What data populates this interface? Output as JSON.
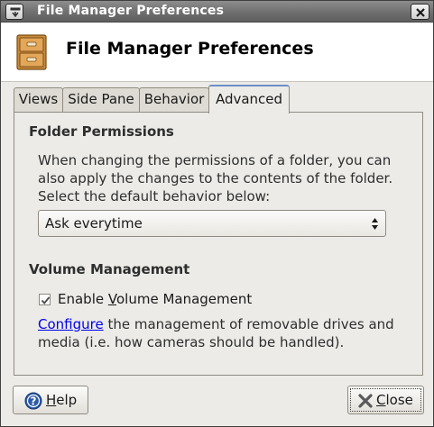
{
  "window": {
    "title": "File Manager Preferences",
    "menu_icon": "window-menu-icon",
    "close_icon": "close-icon"
  },
  "header": {
    "title": "File Manager Preferences",
    "icon": "file-cabinet-icon"
  },
  "tabs": [
    {
      "label": "Views",
      "active": false
    },
    {
      "label": "Side Pane",
      "active": false
    },
    {
      "label": "Behavior",
      "active": false
    },
    {
      "label": "Advanced",
      "active": true
    }
  ],
  "folder_permissions": {
    "title": "Folder Permissions",
    "description": "When changing the permissions of a folder, you can also apply the changes to the contents of the folder. Select the default behavior below:",
    "selected": "Ask everytime"
  },
  "volume_management": {
    "title": "Volume Management",
    "checkbox_label_pre": "Enable ",
    "checkbox_label_mnemonic": "V",
    "checkbox_label_post": "olume Management",
    "checked": true,
    "link_text": "Configure",
    "description_rest": " the management of removable drives and media (i.e. how cameras should be handled)."
  },
  "buttons": {
    "help_mnemonic": "H",
    "help_rest": "elp",
    "close_mnemonic": "C",
    "close_rest": "lose"
  },
  "colors": {
    "title_bar": "#6f6f6f",
    "dialog_bg": "#ecebe7",
    "link": "#0000ee",
    "active_tab_accent": "#6b8fc6",
    "help_icon": "#2d5aa8",
    "close_icon": "#4a4a4a"
  }
}
